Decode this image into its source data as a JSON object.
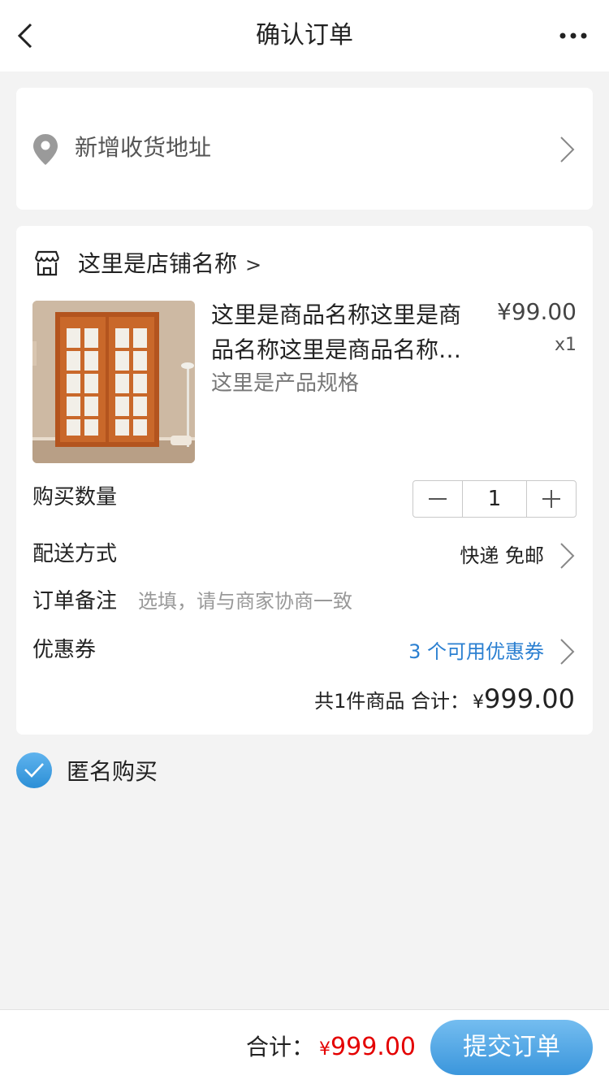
{
  "nav": {
    "title": "确认订单",
    "back_icon": "chevron-left-icon",
    "more_icon": "more-horizontal-icon"
  },
  "address": {
    "label": "新增收货地址",
    "icon": "location-pin-icon"
  },
  "shop": {
    "name": "这里是店铺名称",
    "arrow": ">",
    "icon": "store-icon"
  },
  "product": {
    "name": "这里是商品名称这里是商品名称这里是商品名称这里是商品名称",
    "price": "¥99.00",
    "quantity": "x1",
    "spec": "这里是产品规格",
    "image_alt": "sliding wooden door"
  },
  "quantity_row": {
    "label": "购买数量",
    "value": "1"
  },
  "shipping": {
    "label": "配送方式",
    "value": "快递 免邮"
  },
  "note": {
    "label": "订单备注",
    "placeholder": "选填，请与商家协商一致",
    "value": ""
  },
  "coupon": {
    "label": "优惠券",
    "value": "3 个可用优惠券"
  },
  "summary": {
    "label": "共1件商品  合计：",
    "currency": "¥",
    "amount": "999.00"
  },
  "anonymous": {
    "label": "匿名购买",
    "checked": true
  },
  "footer": {
    "total_label": "合计：",
    "currency": "¥",
    "amount": "999.00",
    "submit_label": "提交订单"
  },
  "colors": {
    "accent": "#3b96dc",
    "price_red": "#e40000",
    "link_blue": "#2a7fd1",
    "background": "#f3f3f3"
  }
}
